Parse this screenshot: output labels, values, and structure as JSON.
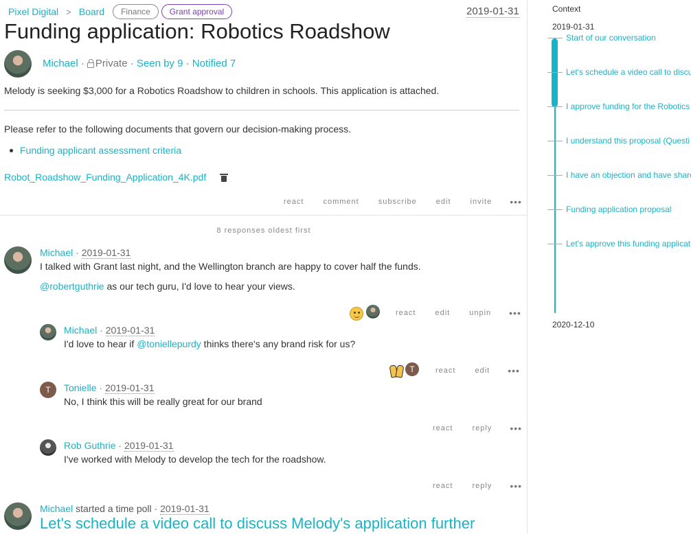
{
  "breadcrumb": {
    "org": "Pixel Digital",
    "separator": ">",
    "group": "Board",
    "tags": [
      "Finance",
      "Grant approval"
    ]
  },
  "thread": {
    "date": "2019-01-31",
    "title": "Funding application: Robotics Roadshow",
    "author": "Michael",
    "privacy": "Private",
    "seen": "Seen by 9",
    "notified": "Notified 7",
    "description": "Melody is seeking $3,000 for a Robotics Roadshow to children in schools. This application is attached.",
    "refer_text": "Please refer to the following documents that govern our decision-making process.",
    "doc_link": "Funding applicant assessment criteria",
    "attachment": "Robot_Roadshow_Funding_Application_4K.pdf",
    "actions": [
      "react",
      "comment",
      "subscribe",
      "edit",
      "invite"
    ],
    "more": "•••"
  },
  "responses_label": "8 responses",
  "sort_label": "oldest first",
  "comments": [
    {
      "author": "Michael",
      "date": "2019-01-31",
      "line1": "I talked with Grant last night, and the Wellington branch are happy to cover half the funds.",
      "mention": "@robertguthrie",
      "line2_rest": " as our tech guru, I'd love to hear your views.",
      "actions": [
        "react",
        "edit",
        "unpin"
      ]
    },
    {
      "author": "Michael",
      "date": "2019-01-31",
      "text_before": "I'd love to hear if ",
      "mention": "@toniellepurdy",
      "text_after": " thinks there's any brand risk for us?",
      "actions": [
        "react",
        "edit"
      ],
      "reactor_initial": "T"
    },
    {
      "author": "Tonielle",
      "initial": "T",
      "date": "2019-01-31",
      "text": "No, I think this will be really great for our brand",
      "actions": [
        "react",
        "reply"
      ]
    },
    {
      "author": "Rob Guthrie",
      "date": "2019-01-31",
      "text": "I've worked with Melody to develop the tech for the roadshow.",
      "actions": [
        "react",
        "reply"
      ]
    }
  ],
  "poll": {
    "author": "Michael",
    "verb": " started a time poll · ",
    "date": "2019-01-31",
    "title": "Let's schedule a video call to discuss Melody's application further"
  },
  "context": {
    "title": "Context",
    "start_date": "2019-01-31",
    "end_date": "2020-12-10",
    "items": [
      "Start of our conversation",
      "Let's schedule a video call to discuss",
      "I approve funding for the Robotics",
      "I understand this proposal (Questi",
      "I have an objection and have share",
      "Funding application proposal",
      "Let's approve this funding applicat"
    ]
  },
  "colors": {
    "accent": "#17b3c7",
    "purple_tag": "#7a3fb0"
  }
}
